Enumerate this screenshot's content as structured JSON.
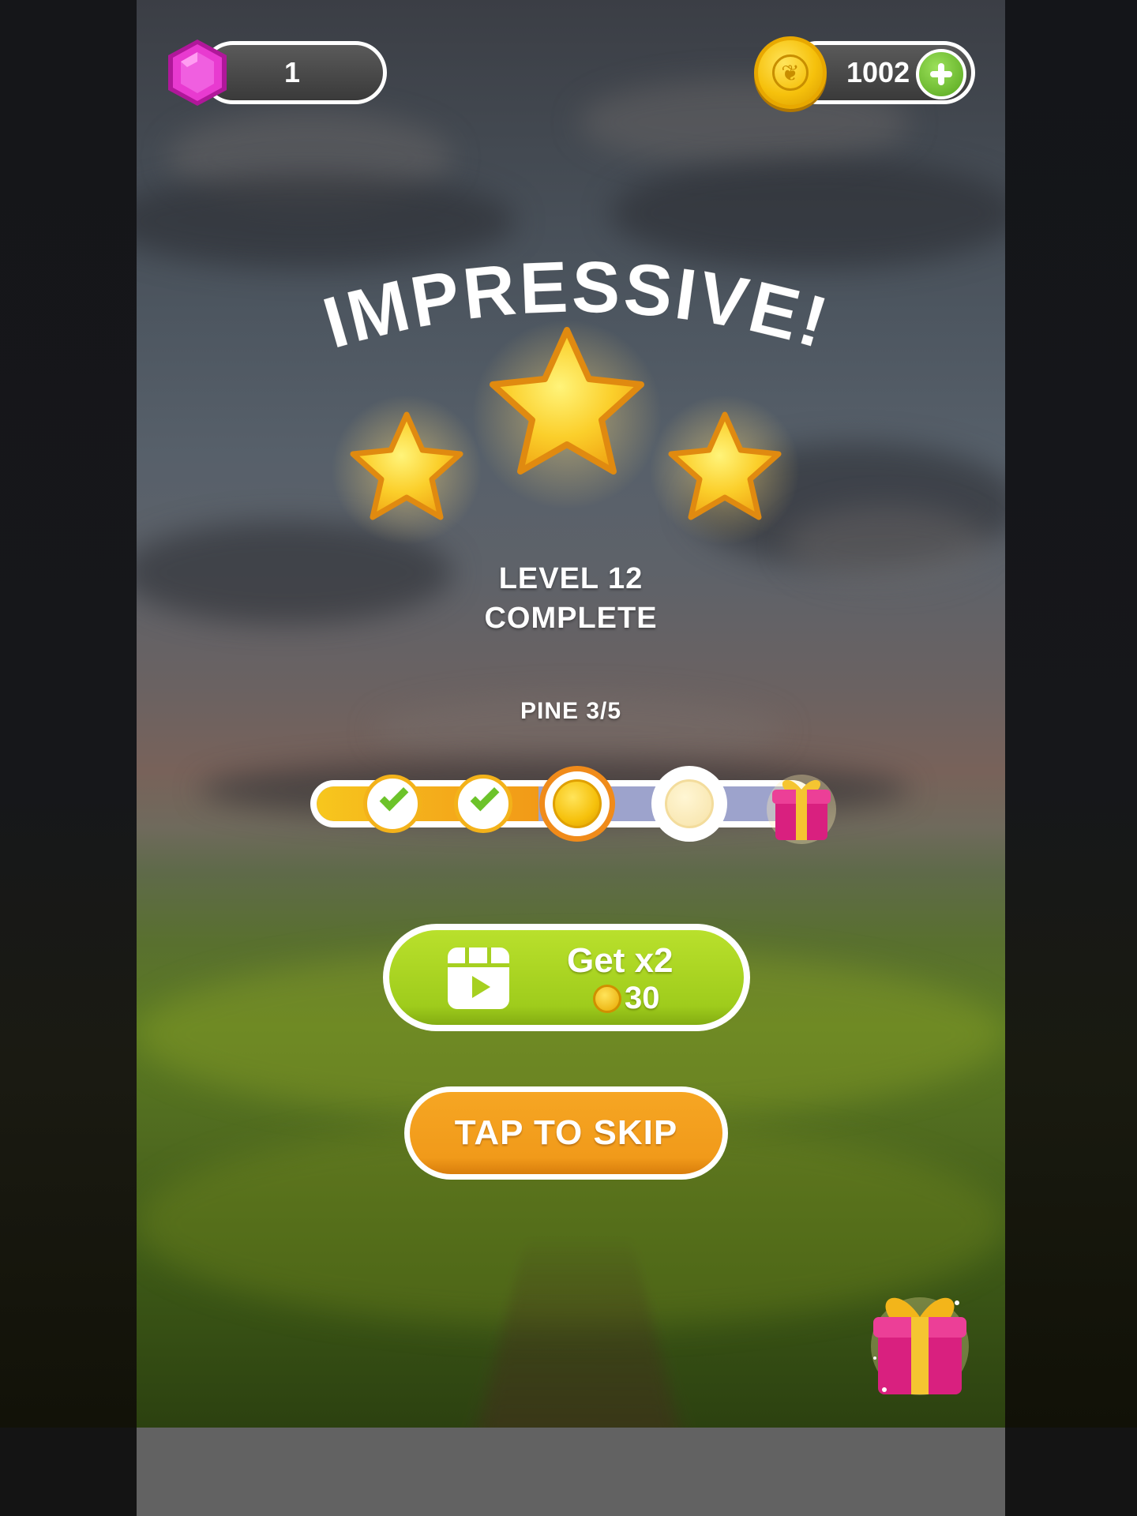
{
  "hud": {
    "gem_count": "1",
    "coin_count": "1002"
  },
  "title": "IMPRESSIVE!",
  "stars_earned": 3,
  "level": {
    "line1": "LEVEL 12",
    "line2": "COMPLETE"
  },
  "collection": {
    "label": "PINE 3/5",
    "current": 3,
    "total": 5
  },
  "double_button": {
    "label": "Get x2",
    "reward": "30"
  },
  "skip_button": {
    "label": "TAP TO SKIP"
  },
  "colors": {
    "gem": "#e83ad0",
    "coin": "#f6c10c",
    "green_button": "#a8d321",
    "orange_button": "#f19a1a",
    "progress_track": "#9da3cc"
  },
  "icons": [
    "gem-icon",
    "coin-icon",
    "plus-icon",
    "star-icon",
    "check-icon",
    "gift-icon",
    "video-icon"
  ]
}
